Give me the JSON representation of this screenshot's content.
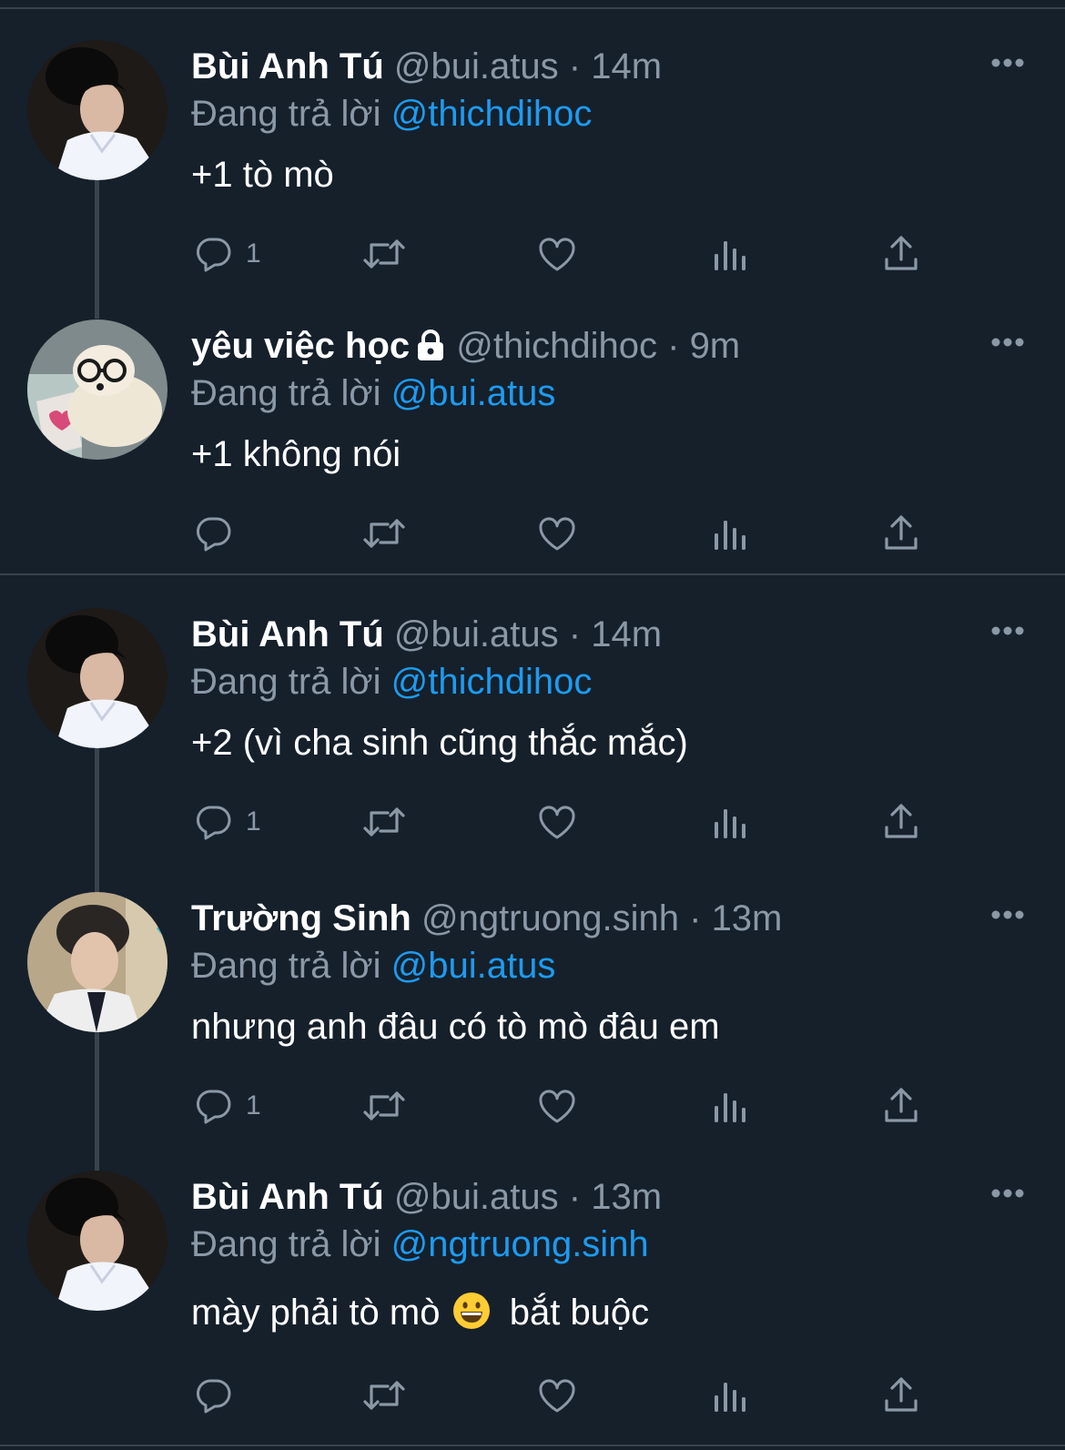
{
  "tweets": [
    {
      "name": "Bùi Anh Tú",
      "handle": "@bui.atus",
      "time": "14m",
      "reply_prefix": "Đang trả lời",
      "reply_to": "@thichdihoc",
      "text": "+1 tò mò",
      "reply_count": "1",
      "avatar": "avatar-bui-atus",
      "locked": false
    },
    {
      "name": "yêu việc học",
      "handle": "@thichdihoc",
      "time": "9m",
      "reply_prefix": "Đang trả lời",
      "reply_to": "@bui.atus",
      "text": "+1 không nói",
      "reply_count": "",
      "avatar": "avatar-thichdihoc",
      "locked": true
    },
    {
      "name": "Bùi Anh Tú",
      "handle": "@bui.atus",
      "time": "14m",
      "reply_prefix": "Đang trả lời",
      "reply_to": "@thichdihoc",
      "text": "+2 (vì cha sinh cũng thắc mắc)",
      "reply_count": "1",
      "avatar": "avatar-bui-atus",
      "locked": false
    },
    {
      "name": "Trường Sinh",
      "handle": "@ngtruong.sinh",
      "time": "13m",
      "reply_prefix": "Đang trả lời",
      "reply_to": "@bui.atus",
      "text": "nhưng anh đâu có tò mò đâu em",
      "reply_count": "1",
      "avatar": "avatar-ngtruong-sinh",
      "locked": false
    },
    {
      "name": "Bùi Anh Tú",
      "handle": "@bui.atus",
      "time": "13m",
      "reply_prefix": "Đang trả lời",
      "reply_to": "@ngtruong.sinh",
      "text_before_emoji": "mày phải tò mò",
      "emoji": "grinning-face-emoji",
      "text_after_emoji": "bắt buộc",
      "reply_count": "",
      "avatar": "avatar-bui-atus",
      "locked": false
    }
  ],
  "separator": "·",
  "colors": {
    "background": "#15202b",
    "text": "#ffffff",
    "muted": "#8b98a5",
    "link": "#1d9bf0",
    "divider": "#38444d"
  },
  "icons": [
    "reply-icon",
    "retweet-icon",
    "like-icon",
    "views-icon",
    "share-icon",
    "more-icon",
    "lock-icon"
  ]
}
